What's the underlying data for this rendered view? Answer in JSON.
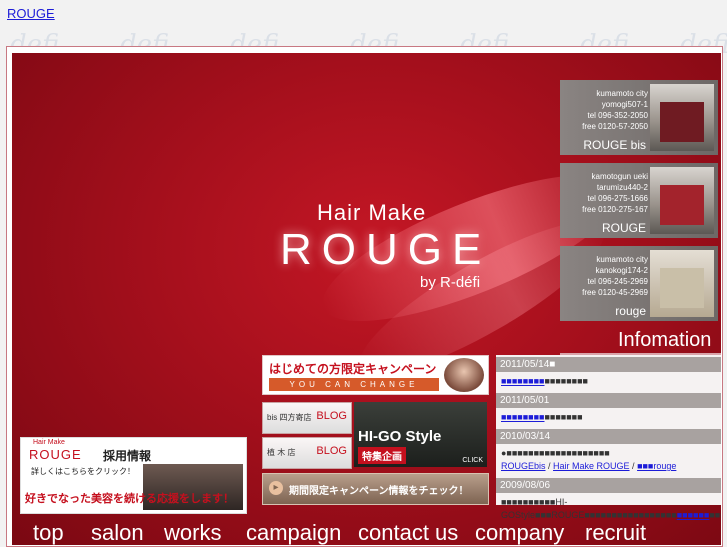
{
  "top_link": "ROUGE",
  "watermark": "defi",
  "logo": {
    "line1": "Hair Make",
    "main": "ROUGE",
    "by": "by R-défi"
  },
  "shops": [
    {
      "address": [
        "kumamoto city",
        "yomogi507-1",
        "tel 096-352-2050",
        "free 0120-57-2050"
      ],
      "name": "ROUGE bis"
    },
    {
      "address": [
        "kamotogun ueki",
        "tarumizu440-2",
        "tel 096-275-1666",
        "free 0120-275-167"
      ],
      "name": "ROUGE"
    },
    {
      "address": [
        "kumamoto city",
        "kanokogi174-2",
        "tel 096-245-2969",
        "free 0120-45-2969"
      ],
      "name": "rouge"
    }
  ],
  "info_title": "Infomation",
  "news": [
    {
      "date": "2011/05/14■",
      "link": "■■■■■■■■",
      "rest": "■■■■■■■■"
    },
    {
      "date": "2011/05/01",
      "link": "■■■■■■■■",
      "rest": "■■■■■■■"
    },
    {
      "date": "2010/03/14",
      "text": "●■■■■■■■■■■■■■■■■■■■",
      "links": [
        "ROUGEbis",
        "Hair Make ROUGE",
        "■■■rouge"
      ],
      "sep": " / "
    },
    {
      "date": "2009/08/06",
      "text1": "■■■■■■■■■■HI-GOStyle■■■ROUGE■■■■■■■■■■■■■■■■■",
      "link": "■■■■■■",
      "rest": "■■■■■■"
    }
  ],
  "banners": {
    "first_time": {
      "title": "はじめての方限定キャンペーン",
      "sub": "YOU CAN CHANGE"
    },
    "blog_bis": {
      "shop": "bis 四方寄店",
      "label": "BLOG"
    },
    "blog_ueki": {
      "shop": "植 木 店",
      "label": "BLOG"
    },
    "higo": {
      "title": "HI-GO Style",
      "sub": "特集企画",
      "click": "CLICK"
    },
    "campaign": {
      "text": "期間限定キャンペーン情報をチェック！"
    },
    "recruit": {
      "hair_make": "Hair Make",
      "rouge": "ROUGE",
      "saiyou": "採用情報",
      "click": "詳しくはこちらをクリック！",
      "message": "好きでなった美容を続ける応援をします！"
    }
  },
  "nav": [
    "top",
    "salon",
    "works",
    "campaign",
    "contact us",
    "company",
    "recruit"
  ],
  "colors": {
    "brand_red": "#c5101e",
    "link": "#1c1cd8"
  }
}
